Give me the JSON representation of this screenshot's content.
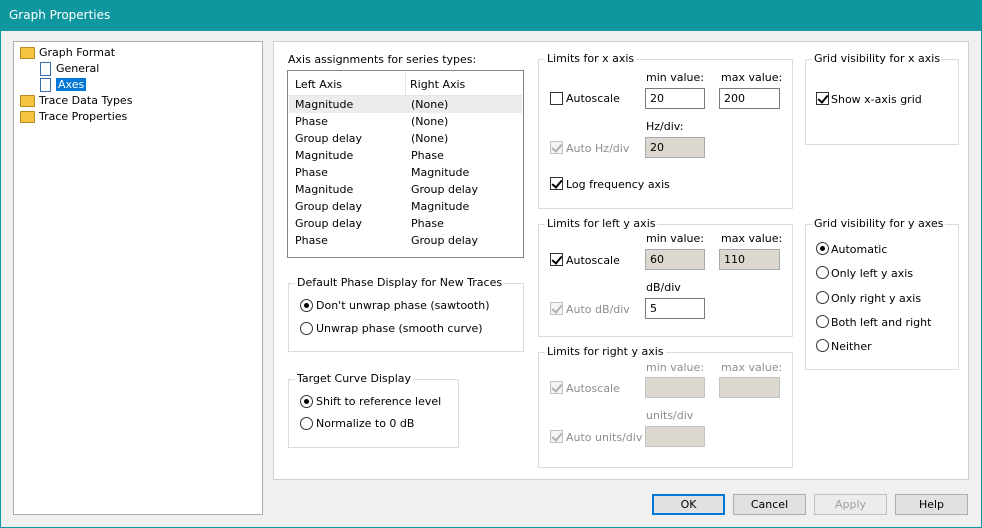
{
  "window": {
    "title": "Graph Properties"
  },
  "tree": {
    "items": [
      {
        "label": "Graph Format"
      },
      {
        "label": "General"
      },
      {
        "label": "Axes"
      },
      {
        "label": "Trace Data Types"
      },
      {
        "label": "Trace Properties"
      }
    ]
  },
  "axis_assign": {
    "title": "Axis assignments for series types:",
    "col_left": "Left Axis",
    "col_right": "Right Axis",
    "rows": [
      {
        "left": "Magnitude",
        "right": "(None)"
      },
      {
        "left": "Phase",
        "right": "(None)"
      },
      {
        "left": "Group delay",
        "right": "(None)"
      },
      {
        "left": "Magnitude",
        "right": "Phase"
      },
      {
        "left": "Phase",
        "right": "Magnitude"
      },
      {
        "left": "Magnitude",
        "right": "Group delay"
      },
      {
        "left": "Group delay",
        "right": "Magnitude"
      },
      {
        "left": "Group delay",
        "right": "Phase"
      },
      {
        "left": "Phase",
        "right": "Group delay"
      }
    ]
  },
  "phase_display": {
    "title": "Default Phase Display for New Traces",
    "opt1": "Don't unwrap phase (sawtooth)",
    "opt2": "Unwrap phase (smooth curve)"
  },
  "target_curve": {
    "title": "Target Curve Display",
    "opt1": "Shift to reference level",
    "opt2": "Normalize to 0 dB"
  },
  "x_limits": {
    "title": "Limits for x axis",
    "autoscale": "Autoscale",
    "min_label": "min value:",
    "max_label": "max value:",
    "min_value": "20",
    "max_value": "200",
    "div_label": "Hz/div:",
    "auto_div": "Auto Hz/div",
    "div_value": "20",
    "log_freq": "Log frequency axis"
  },
  "left_y_limits": {
    "title": "Limits for left y axis",
    "autoscale": "Autoscale",
    "min_label": "min value:",
    "max_label": "max value:",
    "min_value": "60",
    "max_value": "110",
    "div_label": "dB/div",
    "auto_div": "Auto dB/div",
    "div_value": "5"
  },
  "right_y_limits": {
    "title": "Limits for right y axis",
    "autoscale": "Autoscale",
    "min_label": "min value:",
    "max_label": "max value:",
    "div_label": "units/div",
    "auto_div": "Auto units/div"
  },
  "grid_x": {
    "title": "Grid visibility for x axis",
    "show": "Show x-axis grid"
  },
  "grid_y": {
    "title": "Grid visibility for y axes",
    "options": [
      "Automatic",
      "Only left y axis",
      "Only right y axis",
      "Both left and right",
      "Neither"
    ]
  },
  "buttons": {
    "ok": "OK",
    "cancel": "Cancel",
    "apply": "Apply",
    "help": "Help"
  },
  "colors": {
    "titlebar": "#0e979e",
    "selection": "#0078d7"
  }
}
